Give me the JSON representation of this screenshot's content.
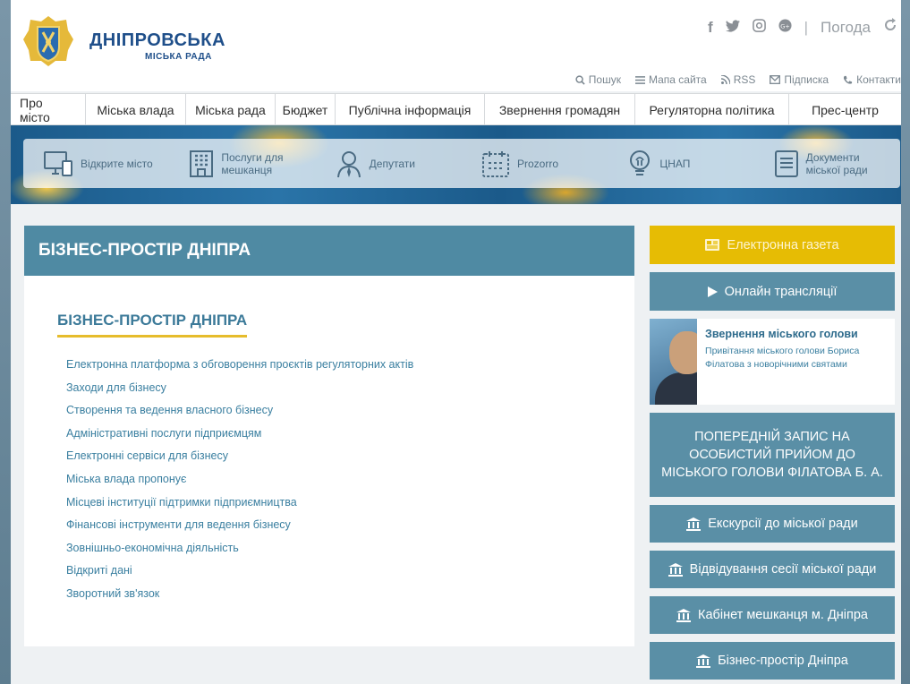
{
  "brand": {
    "title": "ДНІПРОВСЬКА",
    "subtitle": "МІСЬКА РАДА"
  },
  "social": {
    "icons": [
      "facebook-icon",
      "twitter-icon",
      "instagram-icon",
      "google-plus-icon"
    ],
    "weather_label": "Погода"
  },
  "utility_links": [
    {
      "icon": "search-icon",
      "label": "Пошук"
    },
    {
      "icon": "sitemap-icon",
      "label": "Мапа сайта"
    },
    {
      "icon": "rss-icon",
      "label": "RSS"
    },
    {
      "icon": "mail-icon",
      "label": "Підписка"
    },
    {
      "icon": "phone-icon",
      "label": "Контакти"
    }
  ],
  "main_nav": [
    "Про місто",
    "Міська влада",
    "Міська рада",
    "Бюджет",
    "Публічна інформація",
    "Звернення громадян",
    "Регуляторна політика",
    "Прес-центр"
  ],
  "quick_links": [
    {
      "icon": "monitor-icon",
      "label": "Відкрите місто"
    },
    {
      "icon": "building-icon",
      "label": "Послуги для мешканця"
    },
    {
      "icon": "person-icon",
      "label": "Депутати"
    },
    {
      "icon": "calendar-icon",
      "label": "Prozorro"
    },
    {
      "icon": "bulb-icon",
      "label": "ЦНАП"
    },
    {
      "icon": "document-icon",
      "label": "Документи міської ради"
    }
  ],
  "content": {
    "header": "БІЗНЕС-ПРОСТІР ДНІПРА",
    "section_title": "БІЗНЕС-ПРОСТІР ДНІПРА",
    "links": [
      "Електронна платформа з обговорення проєктів регуляторних актів",
      "Заходи для бізнесу",
      "Створення та ведення власного бізнесу",
      "Адміністративні послуги підприємцям",
      "Електронні сервіси для бізнесу",
      "Міська влада пропонує",
      "Місцеві інституції підтримки підприємництва",
      "Фінансові інструменти для ведення бізнесу",
      "Зовнішньо-економічна діяльність",
      "Відкриті дані",
      "Зворотний зв'язок"
    ]
  },
  "sidebar": {
    "newspaper": "Електронна газета",
    "live": "Онлайн трансляції",
    "mayor": {
      "title": "Звернення міського голови",
      "text": "Привітання міського голови Бориса Філатова з новорічними святами"
    },
    "appointment": "ПОПЕРЕДНІЙ ЗАПИС НА ОСОБИСТИЙ ПРИЙОМ ДО МІСЬКОГО ГОЛОВИ ФІЛАТОВА Б. А.",
    "excursions": "Екскурсії до міської ради",
    "session": "Відвідування сесії міської ради",
    "cabinet": "Кабінет мешканця м. Дніпра",
    "business": "Бізнес-простір Дніпра"
  },
  "colors": {
    "primary": "#4f8aa3",
    "accent": "#e6bc04",
    "link": "#3a7fa0",
    "brand": "#1f4f8a"
  }
}
